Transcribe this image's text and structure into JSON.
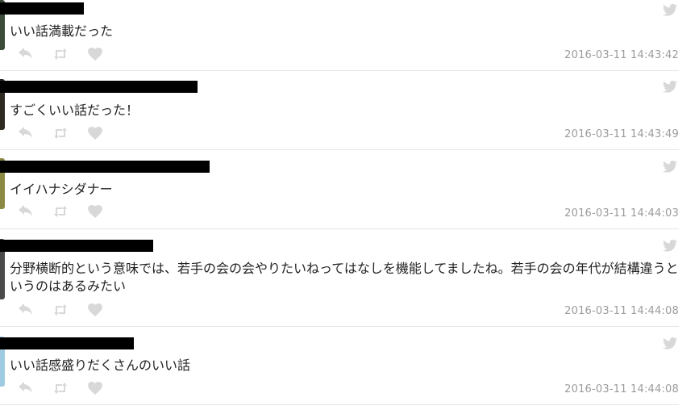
{
  "tweets": [
    {
      "text": "いい話満載だった",
      "timestamp": "2016-03-11 14:43:42"
    },
    {
      "text": "すごくいい話だった！",
      "timestamp": "2016-03-11 14:43:49"
    },
    {
      "text": "イイハナシダナー",
      "timestamp": "2016-03-11 14:44:03"
    },
    {
      "text": "分野横断的という意味では、若手の会の会やりたいねってはなしを機能してましたね。若手の会の年代が結構違うというのはあるみたい",
      "timestamp": "2016-03-11 14:44:08"
    },
    {
      "text": "いい話感盛りだくさんのいい話",
      "timestamp": "2016-03-11 14:44:08"
    }
  ],
  "icons": {
    "service": "twitter-bird-icon",
    "reply": "reply-icon",
    "retweet": "retweet-icon",
    "like": "heart-icon"
  },
  "colors": {
    "icon": "#d8d8d8",
    "text": "#222222",
    "timestamp": "#9b9b9b",
    "divider": "#e6e6e6"
  }
}
